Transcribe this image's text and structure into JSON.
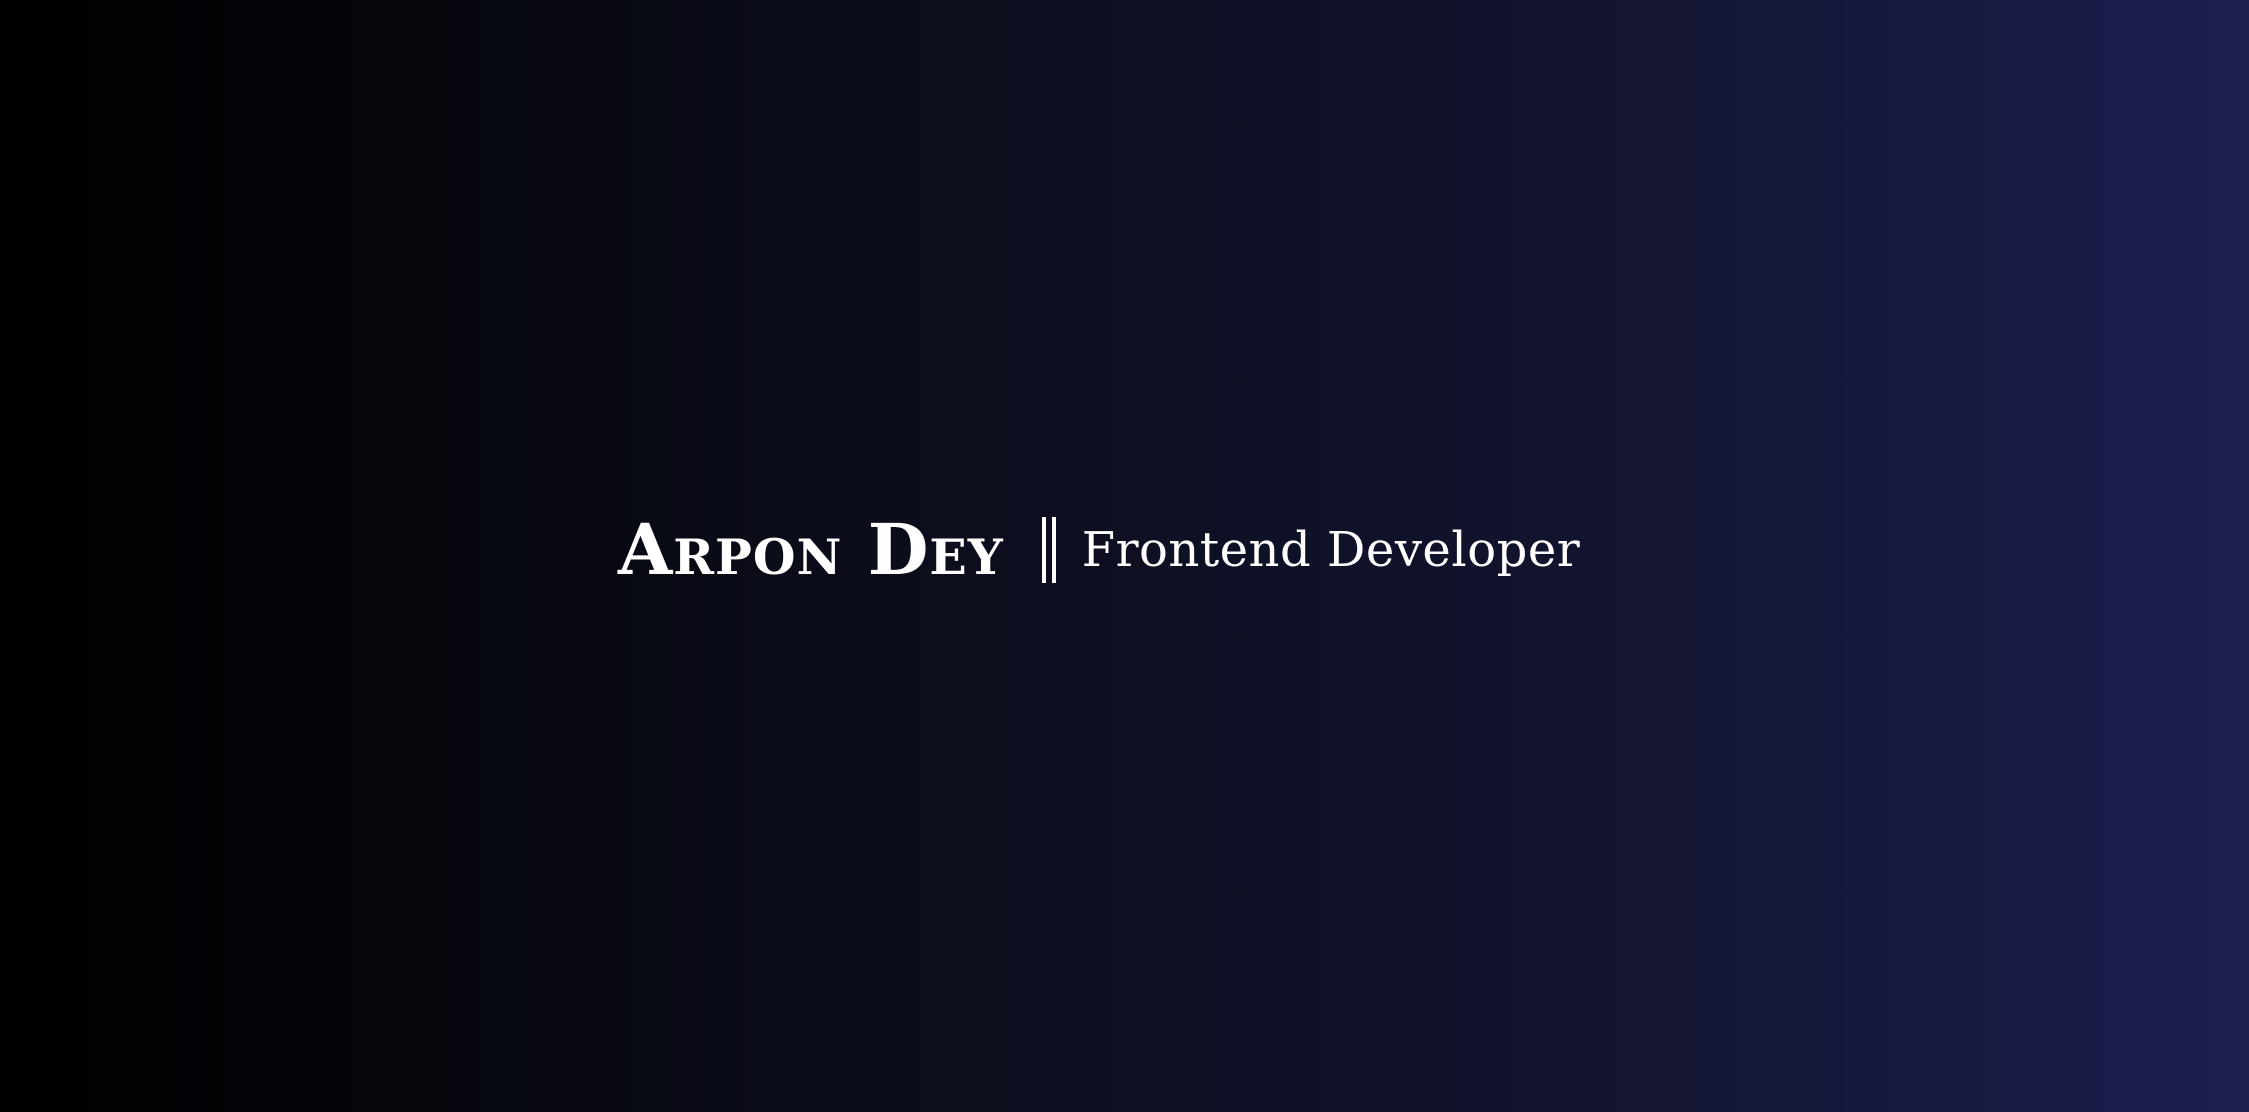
{
  "hero": {
    "name": "Arpon Dey",
    "separator": "||",
    "role": "Frontend Developer"
  },
  "colors": {
    "background_start": "#000000",
    "background_end": "#1c1f4e",
    "text": "#ffffff"
  }
}
